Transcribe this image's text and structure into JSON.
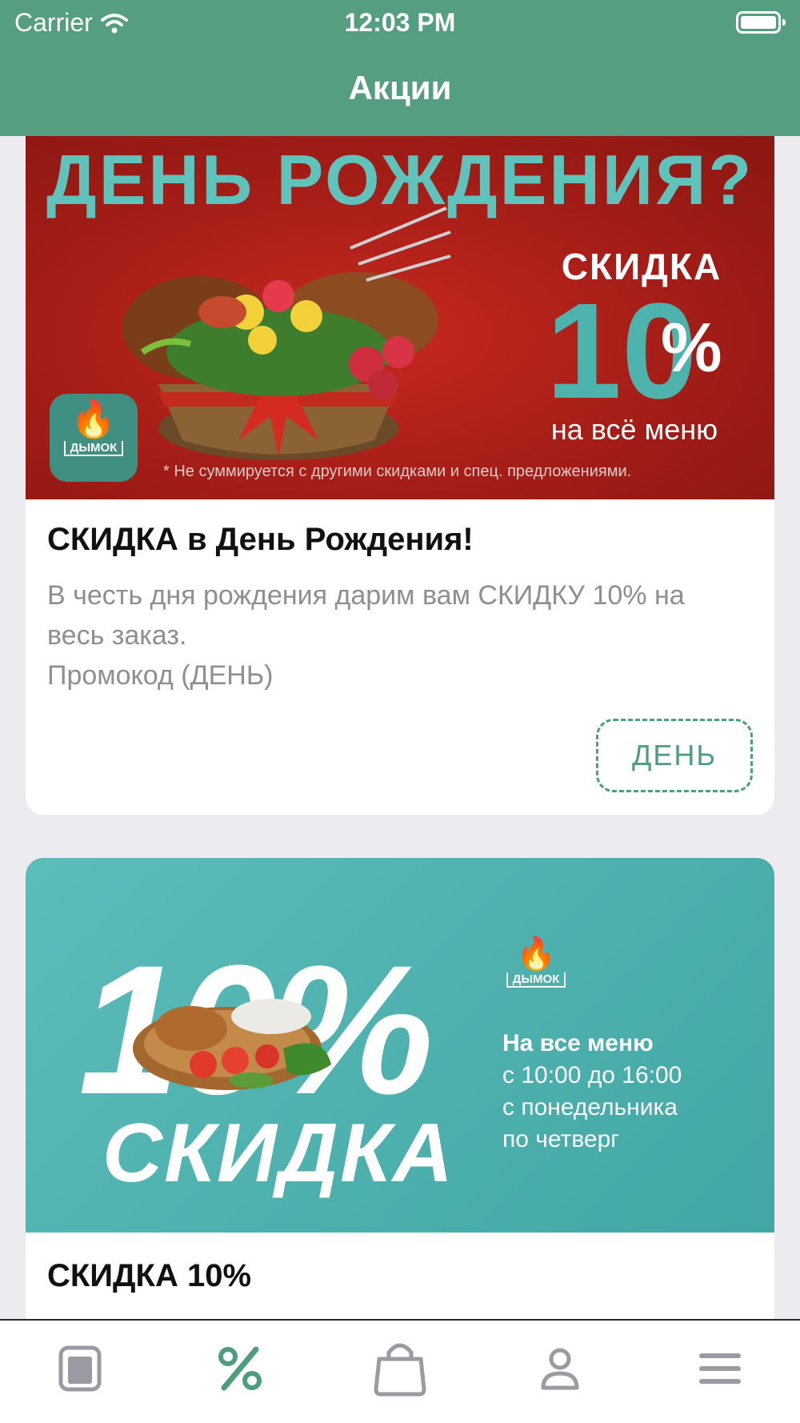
{
  "status_bar": {
    "carrier": "Carrier",
    "time": "12:03 PM"
  },
  "nav": {
    "title": "Акции"
  },
  "promos": [
    {
      "banner": {
        "headline": "ДЕНЬ РОЖДЕНИЯ?",
        "discount_word": "СКИДКА",
        "discount_number": "10",
        "discount_percent": "%",
        "scope": "на всё меню",
        "note": "* Не суммируется с другими скидками и спец. предложениями.",
        "logo_name": "ДЫМОК"
      },
      "title": "СКИДКА в День Рождения!",
      "description": "В честь дня рождения дарим вам СКИДКУ 10% на весь заказ.",
      "promo_line": "Промокод (ДЕНЬ)",
      "promo_code": "ДЕНЬ"
    },
    {
      "banner": {
        "big_percent": "10%",
        "word": "СКИДКА",
        "logo_name": "ДЫМОК",
        "line1": "На все меню",
        "line2": "с 10:00 до 16:00",
        "line3": "с понедельника",
        "line4": "по четверг"
      },
      "title": "СКИДКА 10%"
    }
  ],
  "tabbar": {
    "items": [
      {
        "icon": "menu-book-icon"
      },
      {
        "icon": "percent-icon",
        "active": true
      },
      {
        "icon": "shopping-bag-icon"
      },
      {
        "icon": "profile-icon"
      },
      {
        "icon": "hamburger-menu-icon"
      }
    ]
  },
  "colors": {
    "accent": "#559e80",
    "promo_green": "#4e9d7e",
    "tab_inactive": "#9a9aa2",
    "banner_red": "#b5221a",
    "banner_teal": "#4fb0ad"
  }
}
